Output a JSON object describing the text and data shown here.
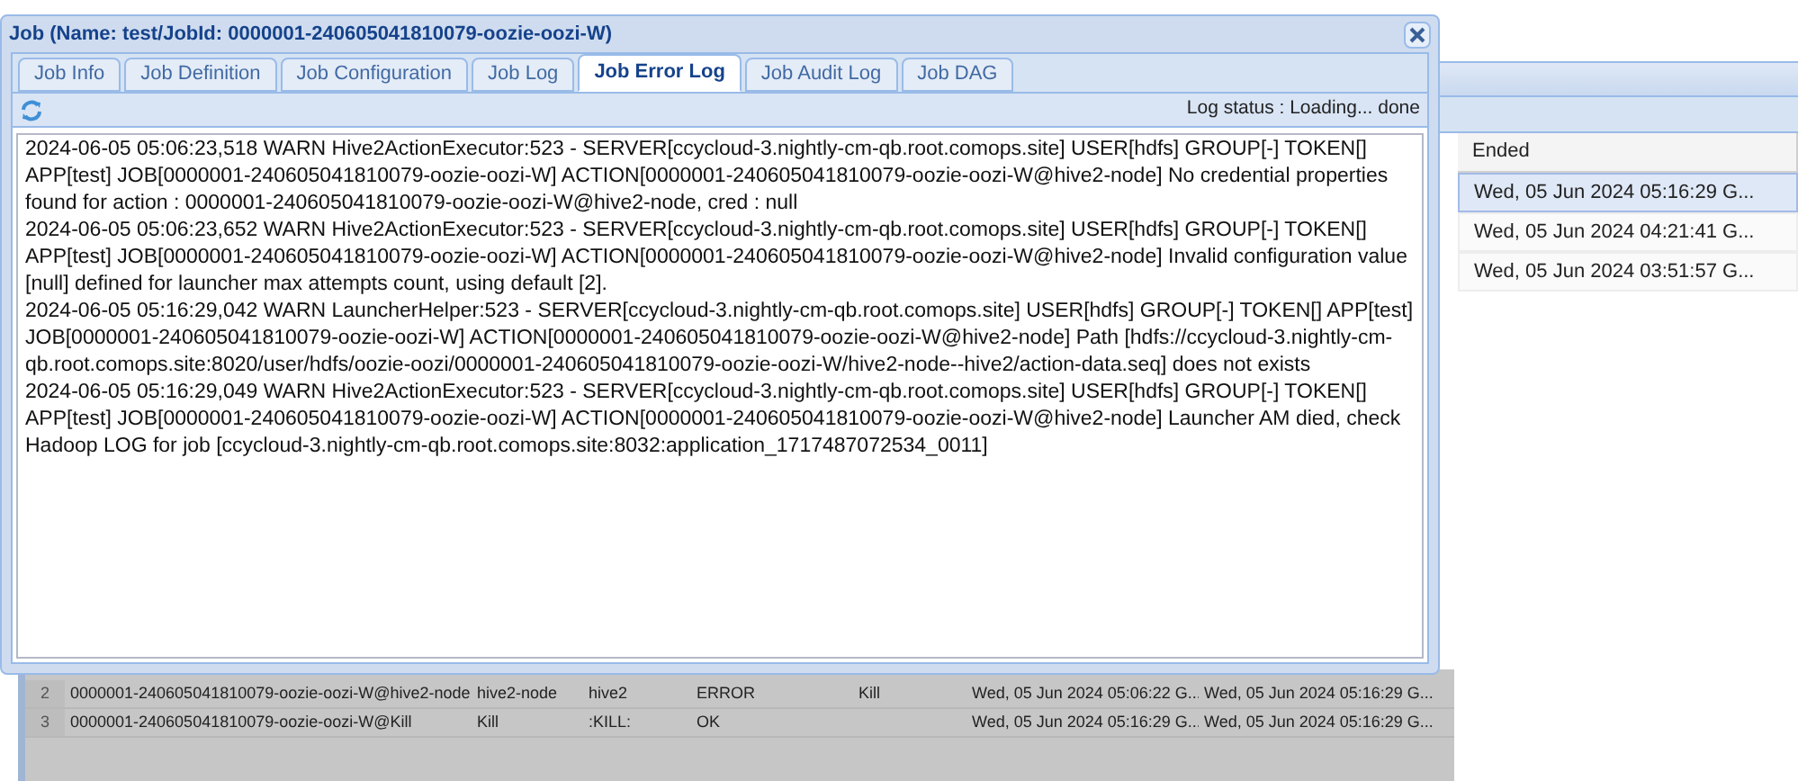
{
  "background_grid": {
    "columns": [
      {
        "label": "Ended"
      }
    ],
    "rows": [
      {
        "ended": "Wed, 05 Jun 2024 05:16:29 G...",
        "selected": true
      },
      {
        "ended": "Wed, 05 Jun 2024 04:21:41 G...",
        "selected": false
      },
      {
        "ended": "Wed, 05 Jun 2024 03:51:57 G...",
        "selected": false
      }
    ]
  },
  "actions_table": {
    "rows": [
      {
        "cells": [
          "2",
          "0000001-240605041810079-oozie-oozi-W@hive2-node",
          "hive2-node",
          "hive2",
          "ERROR",
          "Kill",
          "Wed, 05 Jun 2024 05:06:22 G...",
          "Wed, 05 Jun 2024 05:16:29 G..."
        ]
      },
      {
        "cells": [
          "3",
          "0000001-240605041810079-oozie-oozi-W@Kill",
          "Kill",
          ":KILL:",
          "OK",
          "",
          "Wed, 05 Jun 2024 05:16:29 G...",
          "Wed, 05 Jun 2024 05:16:29 G..."
        ]
      }
    ]
  },
  "dialog": {
    "title": "Job (Name: test/JobId: 0000001-240605041810079-oozie-oozi-W)",
    "tabs": [
      {
        "label": "Job Info",
        "selected": false
      },
      {
        "label": "Job Definition",
        "selected": false
      },
      {
        "label": "Job Configuration",
        "selected": false
      },
      {
        "label": "Job Log",
        "selected": false
      },
      {
        "label": "Job Error Log",
        "selected": true
      },
      {
        "label": "Job Audit Log",
        "selected": false
      },
      {
        "label": "Job DAG",
        "selected": false
      }
    ],
    "log_status": "Log status : Loading... done",
    "log_lines": [
      "2024-06-05 05:06:23,518  WARN Hive2ActionExecutor:523 - SERVER[ccycloud-3.nightly-cm-qb.root.comops.site] USER[hdfs] GROUP[-] TOKEN[] APP[test] JOB[0000001-240605041810079-oozie-oozi-W] ACTION[0000001-240605041810079-oozie-oozi-W@hive2-node] No credential properties found for action : 0000001-240605041810079-oozie-oozi-W@hive2-node, cred : null",
      "2024-06-05 05:06:23,652  WARN Hive2ActionExecutor:523 - SERVER[ccycloud-3.nightly-cm-qb.root.comops.site] USER[hdfs] GROUP[-] TOKEN[] APP[test] JOB[0000001-240605041810079-oozie-oozi-W] ACTION[0000001-240605041810079-oozie-oozi-W@hive2-node] Invalid configuration value [null] defined for launcher max attempts count, using default [2].",
      "2024-06-05 05:16:29,042  WARN LauncherHelper:523 - SERVER[ccycloud-3.nightly-cm-qb.root.comops.site] USER[hdfs] GROUP[-] TOKEN[] APP[test] JOB[0000001-240605041810079-oozie-oozi-W] ACTION[0000001-240605041810079-oozie-oozi-W@hive2-node] Path [hdfs://ccycloud-3.nightly-cm-qb.root.comops.site:8020/user/hdfs/oozie-oozi/0000001-240605041810079-oozie-oozi-W/hive2-node--hive2/action-data.seq] does not exists",
      "2024-06-05 05:16:29,049  WARN Hive2ActionExecutor:523 - SERVER[ccycloud-3.nightly-cm-qb.root.comops.site] USER[hdfs] GROUP[-] TOKEN[] APP[test] JOB[0000001-240605041810079-oozie-oozi-W] ACTION[0000001-240605041810079-oozie-oozi-W@hive2-node] Launcher AM died, check Hadoop LOG for job [ccycloud-3.nightly-cm-qb.root.comops.site:8032:application_1717487072534_0011]"
    ]
  }
}
